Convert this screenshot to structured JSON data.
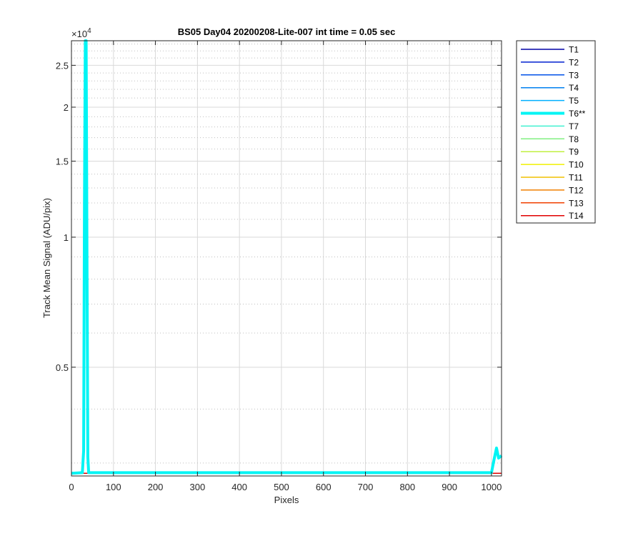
{
  "chart_data": {
    "type": "line",
    "title": "BS05 Day04 20200208-Lite-007 int time = 0.05 sec",
    "xlabel": "Pixels",
    "ylabel": "Track Mean Signal (ADU/pix)",
    "y_exponent_label": "×10",
    "y_exponent_power": "4",
    "xlim": [
      0,
      1024
    ],
    "ylim": [
      2800,
      28500
    ],
    "y_scale": "log",
    "grid": true,
    "x_ticks": [
      0,
      100,
      200,
      300,
      400,
      500,
      600,
      700,
      800,
      900,
      1000
    ],
    "x_tick_labels": [
      "0",
      "100",
      "200",
      "300",
      "400",
      "500",
      "600",
      "700",
      "800",
      "900",
      "1000"
    ],
    "y_ticks": [
      5000,
      10000,
      15000,
      20000,
      25000
    ],
    "y_tick_labels": [
      "0.5",
      "1",
      "1.5",
      "2",
      "2.5"
    ],
    "legend_position": "outside-right",
    "series": [
      {
        "name": "T1",
        "color": "#0000A6",
        "width": 1.5,
        "points": [
          [
            0,
            2840
          ],
          [
            1024,
            2840
          ]
        ]
      },
      {
        "name": "T2",
        "color": "#0020D0",
        "width": 1.5,
        "points": [
          [
            0,
            2840
          ],
          [
            1024,
            2840
          ]
        ]
      },
      {
        "name": "T3",
        "color": "#0050E8",
        "width": 1.5,
        "points": [
          [
            0,
            2840
          ],
          [
            1024,
            2840
          ]
        ]
      },
      {
        "name": "T4",
        "color": "#0080F0",
        "width": 1.5,
        "points": [
          [
            0,
            2840
          ],
          [
            1024,
            2840
          ]
        ]
      },
      {
        "name": "T5",
        "color": "#00B0FF",
        "width": 1.5,
        "points": [
          [
            0,
            2840
          ],
          [
            1024,
            2840
          ]
        ]
      },
      {
        "name": "T6**",
        "color": "#00F4F4",
        "width": 4,
        "points": [
          [
            0,
            2840
          ],
          [
            26,
            2850
          ],
          [
            29,
            3200
          ],
          [
            31,
            12000
          ],
          [
            33,
            28500
          ],
          [
            35,
            28500
          ],
          [
            37,
            9000
          ],
          [
            39,
            3100
          ],
          [
            41,
            2850
          ],
          [
            1000,
            2850
          ],
          [
            1006,
            3050
          ],
          [
            1012,
            3250
          ],
          [
            1017,
            3080
          ],
          [
            1024,
            3120
          ]
        ]
      },
      {
        "name": "T7",
        "color": "#40F0D0",
        "width": 1.5,
        "points": [
          [
            0,
            2840
          ],
          [
            1024,
            2840
          ]
        ]
      },
      {
        "name": "T8",
        "color": "#80F080",
        "width": 1.5,
        "points": [
          [
            0,
            2840
          ],
          [
            1024,
            2840
          ]
        ]
      },
      {
        "name": "T9",
        "color": "#C0F040",
        "width": 1.5,
        "points": [
          [
            0,
            2840
          ],
          [
            1024,
            2840
          ]
        ]
      },
      {
        "name": "T10",
        "color": "#F0F000",
        "width": 1.5,
        "points": [
          [
            0,
            2840
          ],
          [
            1024,
            2840
          ]
        ]
      },
      {
        "name": "T11",
        "color": "#F0C000",
        "width": 1.5,
        "points": [
          [
            0,
            2840
          ],
          [
            1024,
            2840
          ]
        ]
      },
      {
        "name": "T12",
        "color": "#F08000",
        "width": 1.5,
        "points": [
          [
            0,
            2840
          ],
          [
            1024,
            2840
          ]
        ]
      },
      {
        "name": "T13",
        "color": "#F04000",
        "width": 1.5,
        "points": [
          [
            0,
            2840
          ],
          [
            1024,
            2840
          ]
        ]
      },
      {
        "name": "T14",
        "color": "#E00000",
        "width": 1.5,
        "points": [
          [
            0,
            2840
          ],
          [
            1024,
            2840
          ]
        ]
      }
    ]
  }
}
